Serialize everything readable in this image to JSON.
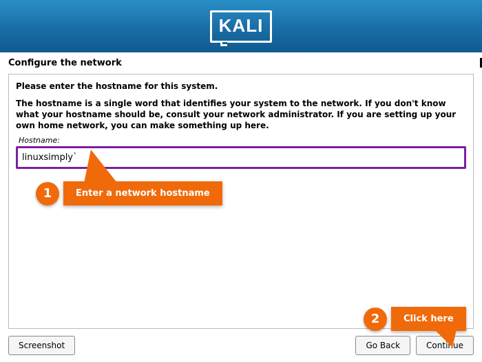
{
  "header": {
    "logo_text": "KALI"
  },
  "page": {
    "title": "Configure the network",
    "instruction_line1": "Please enter the hostname for this system.",
    "instruction_line2": "The hostname is a single word that identifies your system to the network. If you don't know what your hostname should be, consult your network administrator. If you are setting up your own home network, you can make something up here.",
    "field_label": "Hostname:",
    "hostname_value": "linuxsimply`"
  },
  "buttons": {
    "screenshot": "Screenshot",
    "go_back": "Go Back",
    "continue": "Continue"
  },
  "annotations": {
    "step1_num": "1",
    "step1_text": "Enter a network hostname",
    "step2_num": "2",
    "step2_text": "Click here"
  }
}
